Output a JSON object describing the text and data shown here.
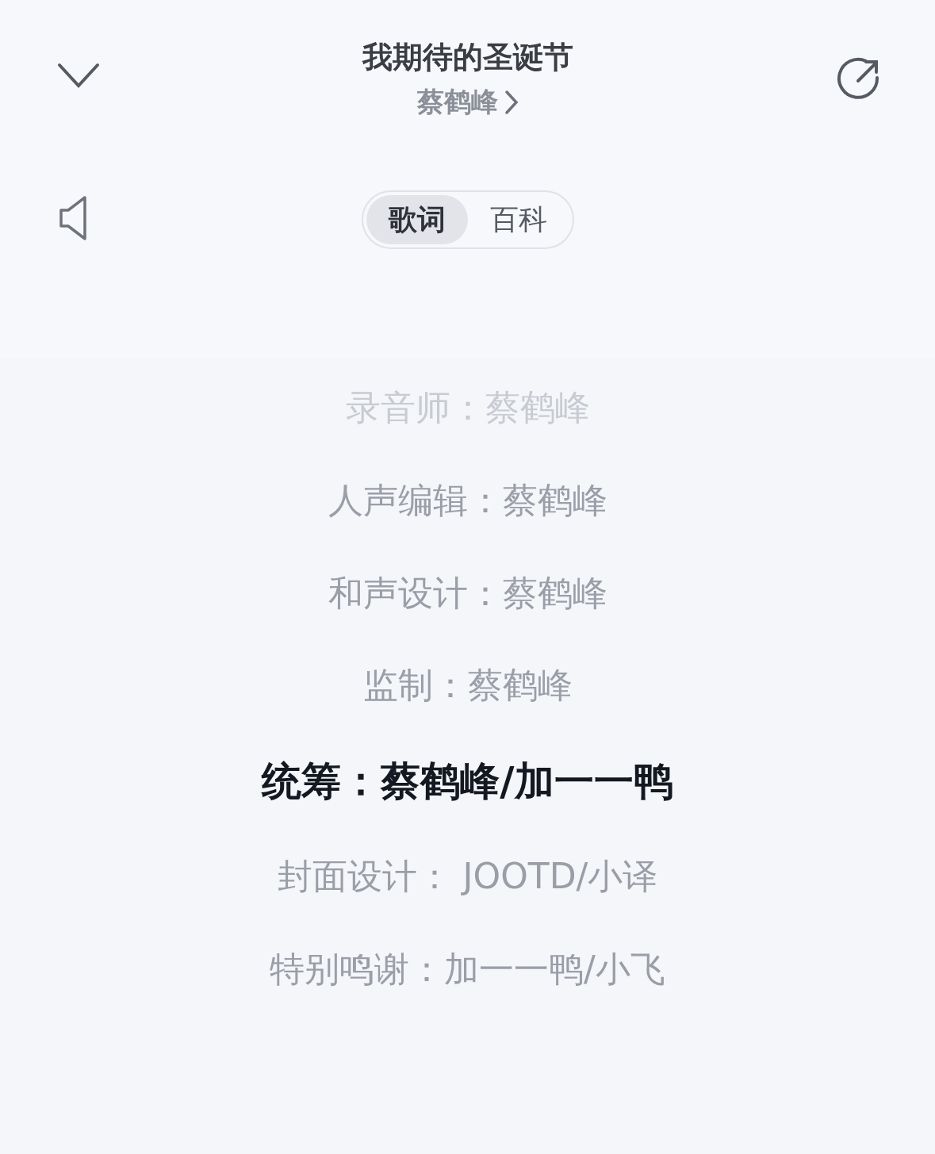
{
  "header": {
    "title": "我期待的圣诞节",
    "artist": "蔡鹤峰"
  },
  "tabs": [
    {
      "label": "歌词",
      "selected": true
    },
    {
      "label": "百科",
      "selected": false
    }
  ],
  "lyrics": [
    {
      "text": "录音师：蔡鹤峰",
      "selected": false,
      "faded": true
    },
    {
      "text": "人声编辑：蔡鹤峰",
      "selected": false,
      "faded": false
    },
    {
      "text": "和声设计：蔡鹤峰",
      "selected": false,
      "faded": false
    },
    {
      "text": "监制：蔡鹤峰",
      "selected": false,
      "faded": false
    },
    {
      "text": "统筹：蔡鹤峰/加一一鸭",
      "selected": true,
      "faded": false
    },
    {
      "text": "封面设计： JOOTD/小译",
      "selected": false,
      "faded": false
    },
    {
      "text": "特别鸣谢：加一一鸭/小飞",
      "selected": false,
      "faded": false
    }
  ]
}
